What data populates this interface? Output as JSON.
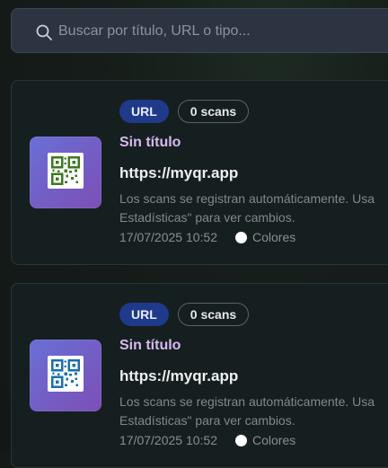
{
  "search": {
    "placeholder": "Buscar por título, URL o tipo..."
  },
  "colors": {
    "qr_green": "#3b7a1c",
    "qr_blue": "#1a6fb0",
    "title_purple": "#d7b9f2",
    "badge_blue": "#1f3a8a"
  },
  "cards": [
    {
      "type_badge": "URL",
      "scans_badge": "0 scans",
      "title": "Sin título",
      "url": "https://myqr.app",
      "description": "Los scans se registran automáticamente. Usa Estadísticas\" para ver cambios.",
      "date": "17/07/2025 10:52",
      "colors_label": "Colores",
      "qr_icon": "qr-code-icon"
    },
    {
      "type_badge": "URL",
      "scans_badge": "0 scans",
      "title": "Sin título",
      "url": "https://myqr.app",
      "description": "Los scans se registran automáticamente. Usa Estadísticas\" para ver cambios.",
      "date": "17/07/2025 10:52",
      "colors_label": "Colores",
      "qr_icon": "qr-code-icon"
    }
  ]
}
